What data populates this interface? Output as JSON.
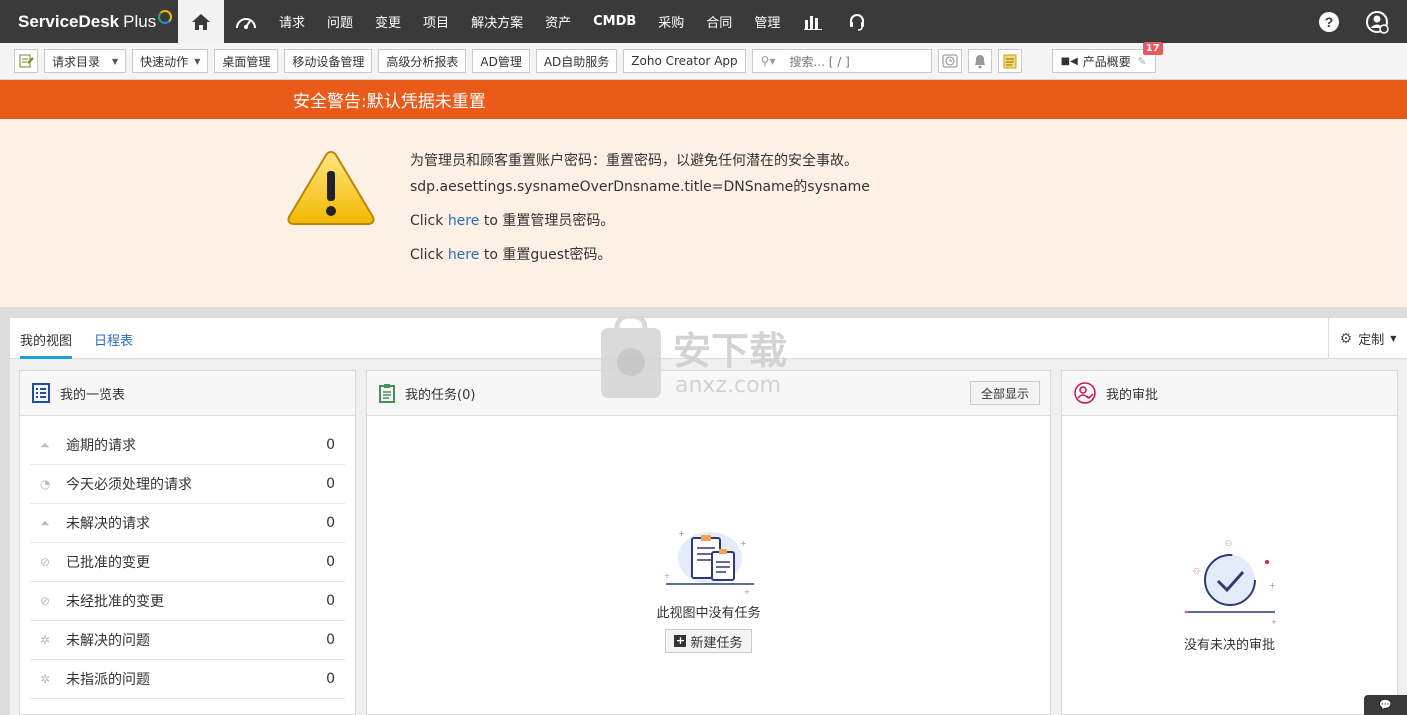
{
  "app": {
    "brand": "ServiceDesk",
    "brand_plus": "Plus"
  },
  "nav": {
    "items": [
      {
        "label": "请求"
      },
      {
        "label": "问题"
      },
      {
        "label": "变更"
      },
      {
        "label": "项目"
      },
      {
        "label": "解决方案"
      },
      {
        "label": "资产"
      },
      {
        "label": "CMDB"
      },
      {
        "label": "采购"
      },
      {
        "label": "合同"
      },
      {
        "label": "管理"
      }
    ],
    "icons": [
      "home-icon",
      "dashboard-icon",
      "reports-icon",
      "support-headset-icon",
      "help-icon",
      "user-profile-icon"
    ]
  },
  "toolbar": {
    "request_catalog": "请求目录",
    "quick_actions": "快速动作",
    "desktop_mgmt": "桌面管理",
    "mobile_device_mgmt": "移动设备管理",
    "advanced_analytics": "高级分析报表",
    "ad_mgmt": "AD管理",
    "ad_self_service": "AD自助服务",
    "zoho_creator": "Zoho Creator App",
    "search_placeholder": "搜索... [ / ]",
    "product_overview": "产品概要",
    "badge_count": "17"
  },
  "alert": {
    "title": "安全警告:默认凭据未重置",
    "line1": "为管理员和顾客重置账户密码：重置密码，以避免任何潜在的安全事故。",
    "line2": "sdp.aesettings.sysnameOverDnsname.title=DNSname的sysname",
    "line3_prefix": "Click ",
    "line3_link": "here",
    "line3_suffix": " to 重置管理员密码。",
    "line4_prefix": "Click ",
    "line4_link": "here",
    "line4_suffix": " to 重置guest密码。"
  },
  "tabs": {
    "my_view": "我的视图",
    "schedule": "日程表",
    "customize": "定制"
  },
  "summary": {
    "title": "我的一览表",
    "rows": [
      {
        "label": "逾期的请求",
        "count": "0"
      },
      {
        "label": "今天必须处理的请求",
        "count": "0"
      },
      {
        "label": "未解决的请求",
        "count": "0"
      },
      {
        "label": "已批准的变更",
        "count": "0"
      },
      {
        "label": "未经批准的变更",
        "count": "0"
      },
      {
        "label": "未解决的问题",
        "count": "0"
      },
      {
        "label": "未指派的问题",
        "count": "0"
      }
    ]
  },
  "tasks": {
    "title": "我的任务(0)",
    "show_all": "全部显示",
    "empty": "此视图中没有任务",
    "new_task": "新建任务"
  },
  "approvals": {
    "title": "我的审批",
    "empty": "没有未决的审批"
  },
  "colors": {
    "nav_bg": "#3a3a3a",
    "alert": "#ea5a19",
    "alert_body": "#fdf1e5",
    "link": "#2a6ebb",
    "tab_accent": "#1aa3d6"
  }
}
